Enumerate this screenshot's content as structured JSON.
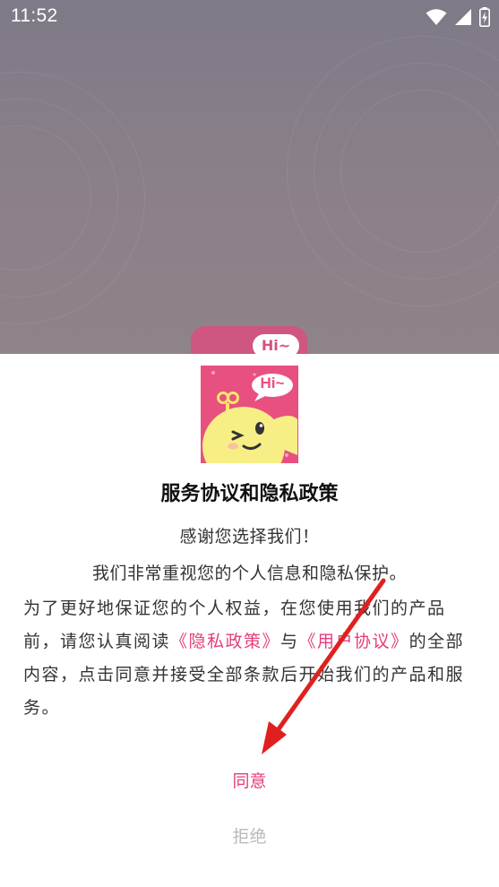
{
  "status_bar": {
    "time": "11:52",
    "icons": [
      "wifi-icon",
      "cellular-signal-icon",
      "battery-charging-icon"
    ]
  },
  "background_app": {
    "logo_text": "Hi~"
  },
  "dialog": {
    "logo_bubble_text": "Hi~",
    "title": "服务协议和隐私政策",
    "line1": "感谢您选择我们！",
    "line2": "我们非常重视您的个人信息和隐私保护。",
    "body_part1": "为了更好地保证您的个人权益，在您使用我们的产品前，请您认真阅读",
    "privacy_link": "《隐私政策》",
    "body_part2": "与",
    "user_agreement_link": "《用户协议》",
    "body_part3": "的全部内容，点击同意并接受全部条款后开始我们的产品和服务。",
    "agree_label": "同意",
    "reject_label": "拒绝"
  },
  "colors": {
    "accent": "#e33d7c",
    "logo_bg": "#e8507f",
    "arrow": "#e0201f",
    "muted": "#b9b9b9"
  }
}
